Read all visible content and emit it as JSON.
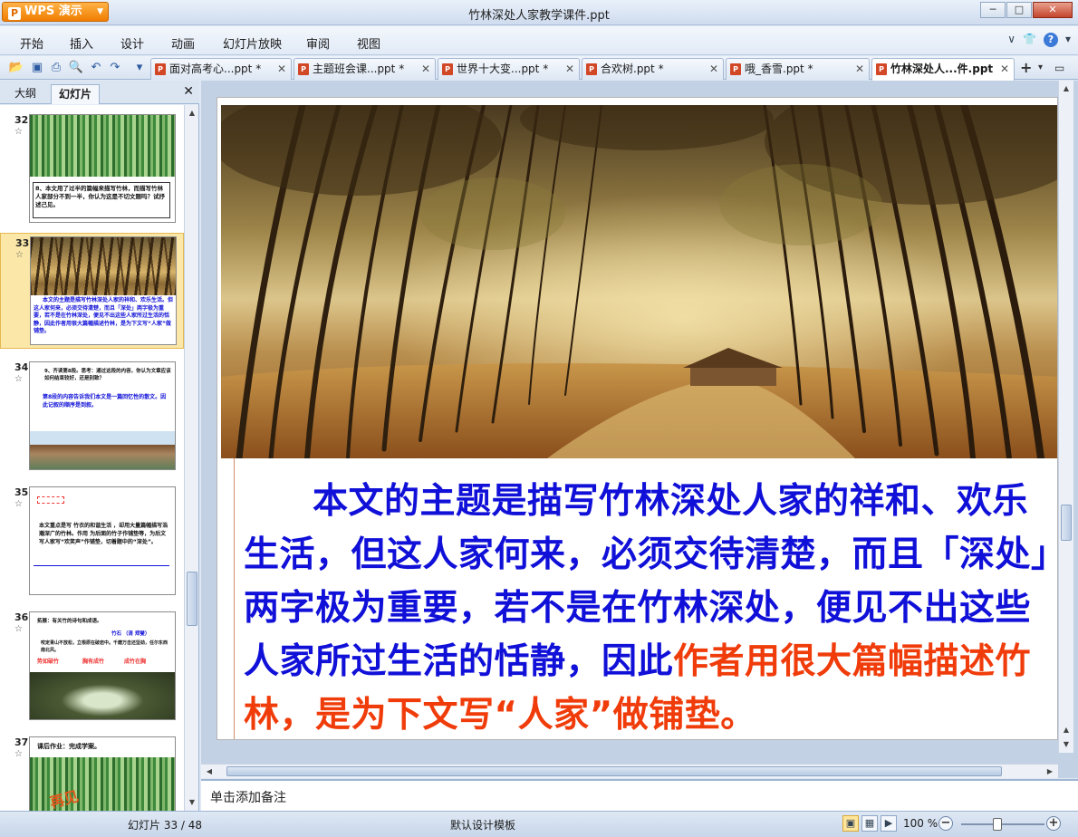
{
  "app": {
    "button_label": "WPS 演示",
    "logo_letter": "P",
    "window_title": "竹林深处人家教学课件.ppt"
  },
  "menu": [
    "开始",
    "插入",
    "设计",
    "动画",
    "幻灯片放映",
    "审阅",
    "视图"
  ],
  "tabs": [
    {
      "label": "面对高考心...ppt *"
    },
    {
      "label": "主题班会课...ppt *"
    },
    {
      "label": "世界十大变...ppt *"
    },
    {
      "label": "合欢树.ppt *"
    },
    {
      "label": "哦_香雪.ppt *"
    },
    {
      "label": "竹林深处人...件.ppt",
      "active": true
    }
  ],
  "panel": {
    "tab_outline": "大纲",
    "tab_slides": "幻灯片"
  },
  "thumbnails": [
    {
      "num": "32",
      "text": "8、本文用了过半的篇幅来描写竹林，而描写竹林人家部分不到一半，你认为这是不切文题吗？试抒述己见。"
    },
    {
      "num": "33",
      "selected": true,
      "text": "本文的主题是描写竹林深处人家的祥和、欢乐生活。但这人家何来，必须交待清楚，而且「深处」两字极为重要，若不是在竹林深处，便见不出这些人家所过生活的恬静，因此作者用很大篇幅描述竹林，是为下文写“人家”做铺垫。"
    },
    {
      "num": "34",
      "text1": "9、齐读第8段。思考：通过这段的内容，你认为文章应该如何结束较好，还是别致？",
      "text2": "第8段的内容告诉我们本文是一篇回忆性的散文。因此记叙的顺序是到叙。"
    },
    {
      "num": "35",
      "text": "本文重点是写 竹衣的和谐生活 ，却用大量篇幅描写浩瀚深广的竹林。作用 为后面的竹子作铺垫等，为后文写人家写“欢笑声”作铺垫，切着题中的“深处”。"
    },
    {
      "num": "36",
      "text1": "拓展：有关竹的诗句和成语。",
      "text2": "竹石 （清 郑燮）",
      "text3": "咬定青山不放松，立根原在破岩中。千磨万击还坚劲，任尔东西南北风。",
      "idioms": [
        "势如破竹",
        "胸有成竹",
        "成竹在胸"
      ]
    },
    {
      "num": "37",
      "text": "课后作业：完成学案。",
      "bye": "再见"
    }
  ],
  "slide": {
    "text_blue": "本文的主题是描写竹林深处人家的祥和、欢乐生活，但这人家何来，必须交待清楚，而且「深处」两字极为重要，若不是在竹林深处，便见不出这些人家所过生活的恬静，因此",
    "text_red": "作者用很大篇幅描述竹林，是为下文写“人家”做铺垫。"
  },
  "notes": {
    "placeholder": "单击添加备注"
  },
  "status": {
    "slide_counter": "幻灯片 33 / 48",
    "template": "默认设计模板",
    "zoom": "100 %"
  },
  "colors": {
    "slide_text_blue": "#1010d8",
    "slide_text_red": "#f03c0a",
    "accent_orange": "#f07d00"
  }
}
